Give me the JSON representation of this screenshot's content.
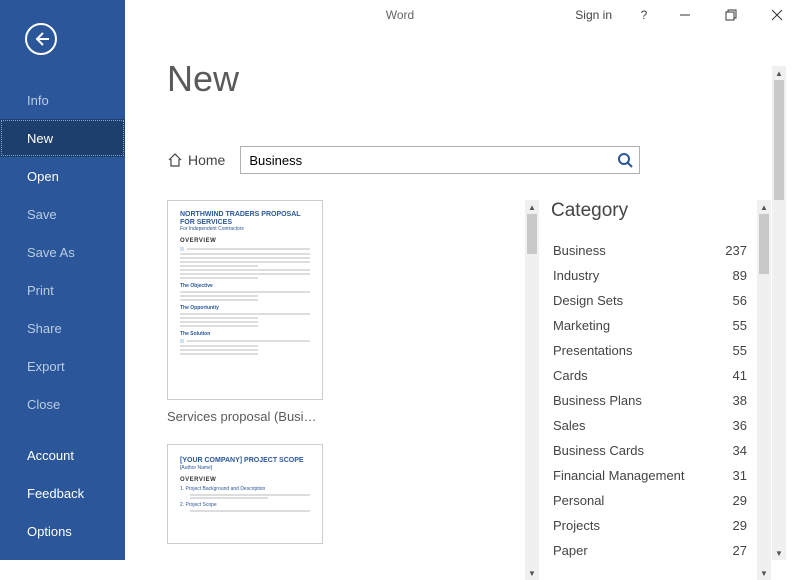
{
  "titlebar": {
    "app_title": "Word",
    "signin_label": "Sign in",
    "help_label": "?"
  },
  "sidebar": {
    "items": [
      {
        "label": "Info",
        "enabled": false
      },
      {
        "label": "New",
        "enabled": true,
        "selected": true
      },
      {
        "label": "Open",
        "enabled": true
      },
      {
        "label": "Save",
        "enabled": false
      },
      {
        "label": "Save As",
        "enabled": false
      },
      {
        "label": "Print",
        "enabled": false
      },
      {
        "label": "Share",
        "enabled": false
      },
      {
        "label": "Export",
        "enabled": false
      },
      {
        "label": "Close",
        "enabled": false
      }
    ],
    "bottom_items": [
      {
        "label": "Account"
      },
      {
        "label": "Feedback"
      },
      {
        "label": "Options"
      }
    ]
  },
  "main": {
    "heading": "New",
    "home_label": "Home",
    "search": {
      "value": "Business"
    },
    "templates": [
      {
        "caption": "Services proposal (Busi…",
        "thumb_title": "NORTHWIND TRADERS PROPOSAL FOR SERVICES",
        "thumb_sub": "For Independent Contractors",
        "thumb_h1": "OVERVIEW",
        "thumb_s1": "The Objective",
        "thumb_s2": "The Opportunity",
        "thumb_s3": "The Solution"
      },
      {
        "caption": "",
        "thumb_title": "[YOUR COMPANY] PROJECT SCOPE",
        "thumb_author": "[Author Name]",
        "thumb_h1": "OVERVIEW",
        "thumb_l1": "1.  Project Background and Description",
        "thumb_l2": "2.  Project Scope"
      }
    ],
    "category": {
      "title": "Category",
      "items": [
        {
          "name": "Business",
          "count": 237
        },
        {
          "name": "Industry",
          "count": 89
        },
        {
          "name": "Design Sets",
          "count": 56
        },
        {
          "name": "Marketing",
          "count": 55
        },
        {
          "name": "Presentations",
          "count": 55
        },
        {
          "name": "Cards",
          "count": 41
        },
        {
          "name": "Business Plans",
          "count": 38
        },
        {
          "name": "Sales",
          "count": 36
        },
        {
          "name": "Business Cards",
          "count": 34
        },
        {
          "name": "Financial Management",
          "count": 31
        },
        {
          "name": "Personal",
          "count": 29
        },
        {
          "name": "Projects",
          "count": 29
        },
        {
          "name": "Paper",
          "count": 27
        }
      ]
    }
  }
}
